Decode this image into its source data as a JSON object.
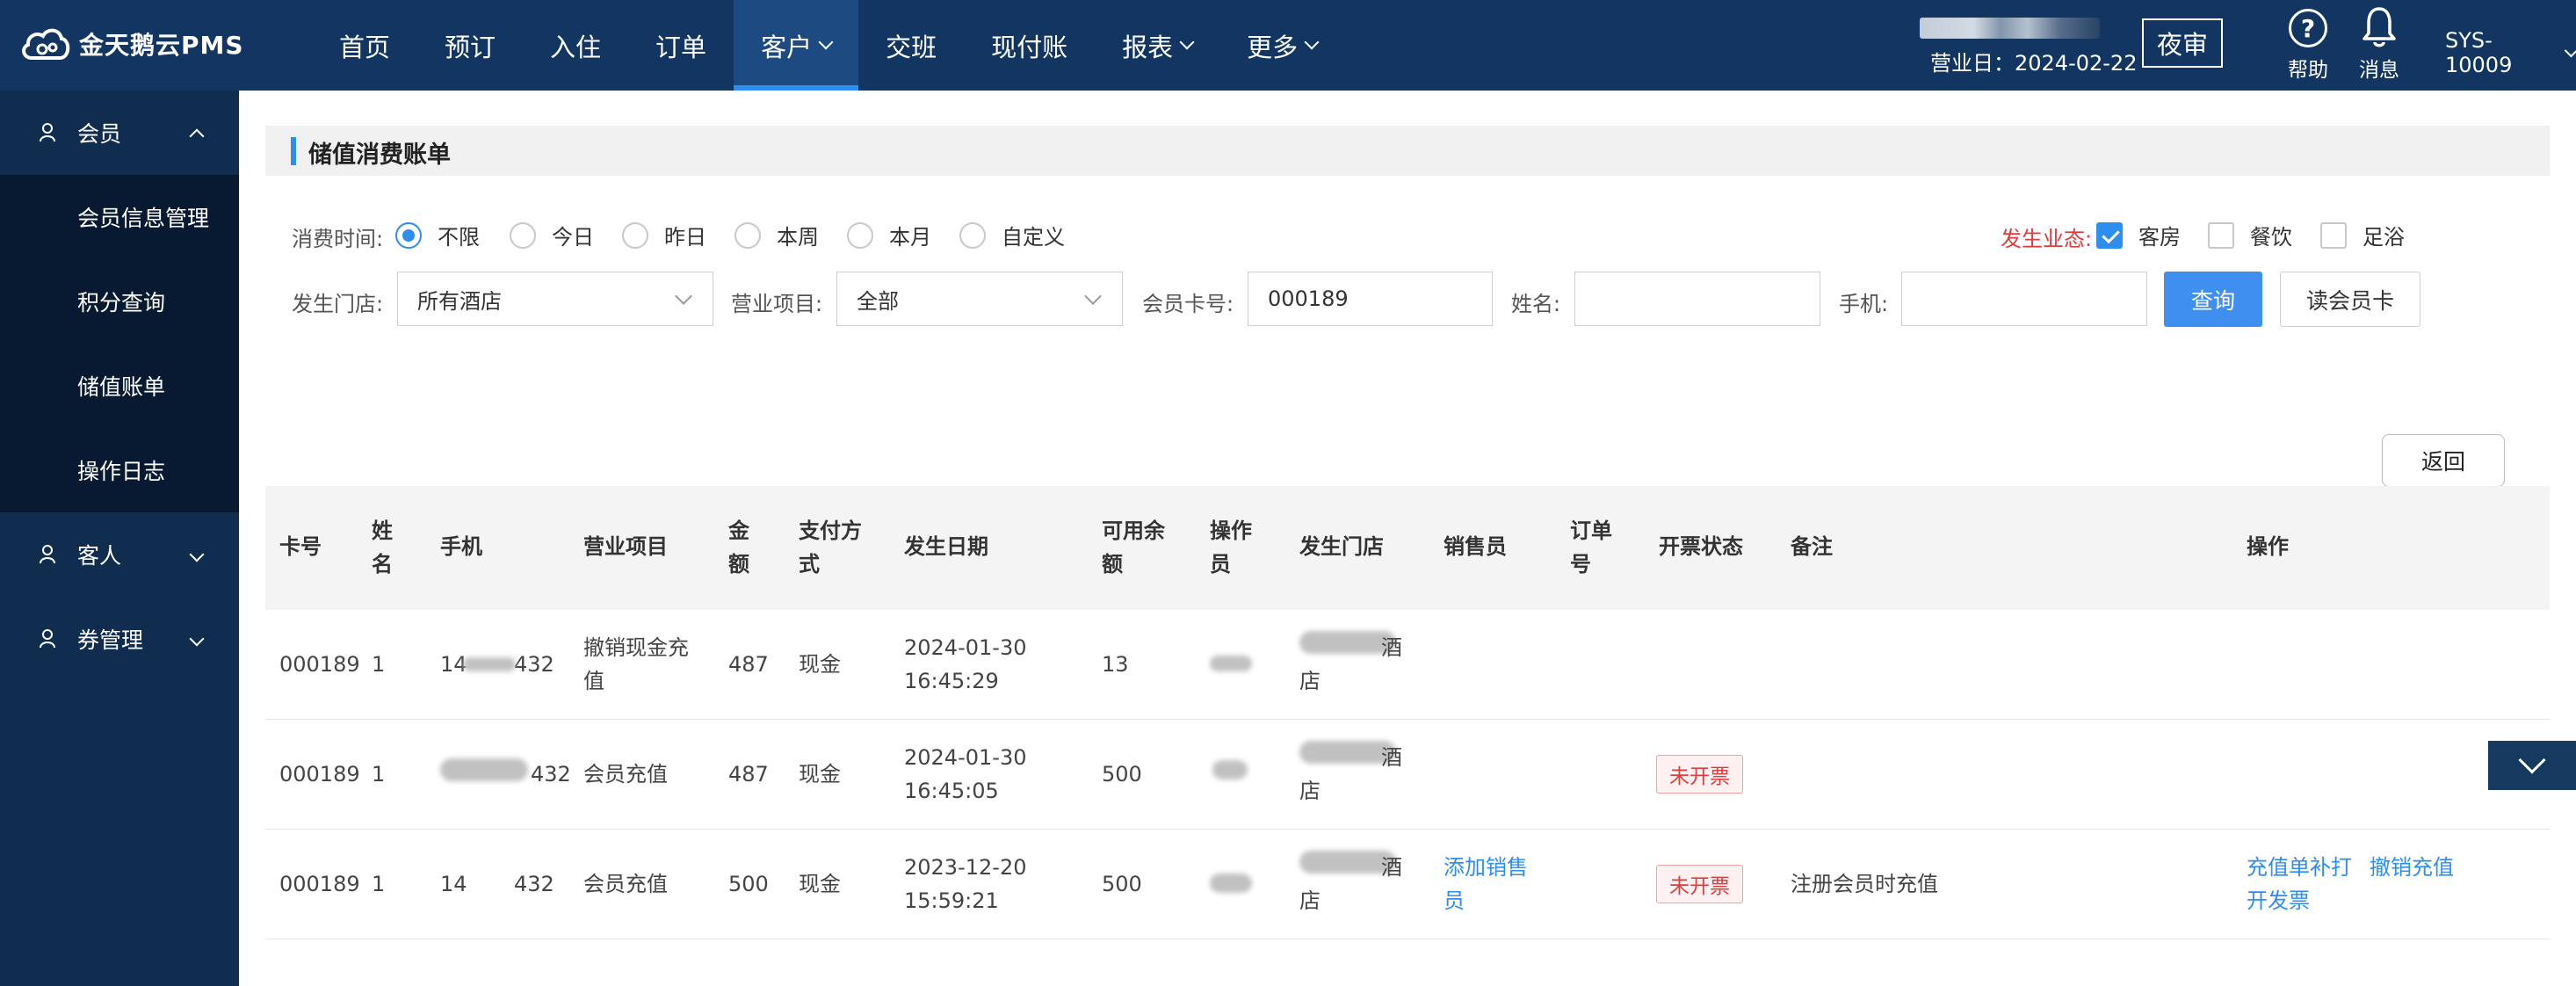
{
  "app": {
    "logo_text": "金天鹅云PMS"
  },
  "nav": [
    {
      "label": "首页",
      "dropdown": false,
      "active": false
    },
    {
      "label": "预订",
      "dropdown": false,
      "active": false
    },
    {
      "label": "入住",
      "dropdown": false,
      "active": false
    },
    {
      "label": "订单",
      "dropdown": false,
      "active": false
    },
    {
      "label": "客户",
      "dropdown": true,
      "active": true
    },
    {
      "label": "交班",
      "dropdown": false,
      "active": false
    },
    {
      "label": "现付账",
      "dropdown": false,
      "active": false
    },
    {
      "label": "报表",
      "dropdown": true,
      "active": false
    },
    {
      "label": "更多",
      "dropdown": true,
      "active": false
    }
  ],
  "header": {
    "business_date": "营业日：2024-02-22",
    "night_audit": "夜审",
    "help": "帮助",
    "help_icon_glyph": "?",
    "message": "消息",
    "user": "SYS-10009"
  },
  "sidebar": {
    "groups": [
      {
        "label": "会员",
        "expanded": true,
        "items": [
          "会员信息管理",
          "积分查询",
          "储值账单",
          "操作日志"
        ]
      },
      {
        "label": "客人",
        "expanded": false,
        "items": []
      },
      {
        "label": "券管理",
        "expanded": false,
        "items": []
      }
    ]
  },
  "page": {
    "title": "储值消费账单"
  },
  "filters": {
    "time_label": "消费时间:",
    "time_options": [
      {
        "label": "不限",
        "selected": true
      },
      {
        "label": "今日",
        "selected": false
      },
      {
        "label": "昨日",
        "selected": false
      },
      {
        "label": "本周",
        "selected": false
      },
      {
        "label": "本月",
        "selected": false
      },
      {
        "label": "自定义",
        "selected": false
      }
    ],
    "biz_label": "发生业态:",
    "biz_options": [
      {
        "label": "客房",
        "checked": true
      },
      {
        "label": "餐饮",
        "checked": false
      },
      {
        "label": "足浴",
        "checked": false
      }
    ],
    "store_label": "发生门店:",
    "store_value": "所有酒店",
    "item_label": "营业项目:",
    "item_value": "全部",
    "card_label": "会员卡号:",
    "card_value": "000189",
    "name_label": "姓名:",
    "name_value": "",
    "phone_label": "手机:",
    "phone_value": "",
    "query_btn": "查询",
    "read_card_btn": "读会员卡",
    "back_btn": "返回"
  },
  "table": {
    "headers": [
      "卡号",
      "姓名",
      "手机",
      "营业项目",
      "金额",
      "支付方式",
      "发生日期",
      "可用余额",
      "操作员",
      "发生门店",
      "销售员",
      "订单号",
      "开票状态",
      "备注",
      "操作"
    ],
    "rows": [
      {
        "card": "000189",
        "name": "1",
        "phone": "14       432",
        "item": "撤销现金充值",
        "amount": "487",
        "pay": "现金",
        "date": "2024-01-30",
        "time": "16:45:29",
        "balance": "13",
        "operator": "",
        "store": "店",
        "store_top": "酒",
        "seller": "",
        "order": "",
        "invoice": "",
        "remark": "",
        "ops": []
      },
      {
        "card": "000189",
        "name": "1",
        "phone": "432",
        "item": "会员充值",
        "amount": "487",
        "pay": "现金",
        "date": "2024-01-30",
        "time": "16:45:05",
        "balance": "500",
        "operator": "",
        "store": "店",
        "store_top": "酒",
        "seller": "",
        "order": "",
        "invoice": "未开票",
        "remark": "",
        "ops": []
      },
      {
        "card": "000189",
        "name": "1",
        "phone": "14       432",
        "item": "会员充值",
        "amount": "500",
        "pay": "现金",
        "date": "2023-12-20",
        "time": "15:59:21",
        "balance": "500",
        "operator": "",
        "store": "店",
        "store_top": "酒",
        "seller": "添加销售员",
        "order": "",
        "invoice": "未开票",
        "remark": "注册会员时充值",
        "ops": [
          "充值单补打",
          "撤销充值",
          "开发票"
        ]
      }
    ]
  },
  "colors": {
    "topbar": "#123661",
    "sidebar": "#102c4f",
    "accent": "#2e8ef0",
    "danger": "#e03c3c"
  },
  "icons": [
    "cloud-logo-icon",
    "chevron-down-icon",
    "help-circle-icon",
    "bell-icon",
    "user-icon",
    "chevron-up-icon"
  ]
}
